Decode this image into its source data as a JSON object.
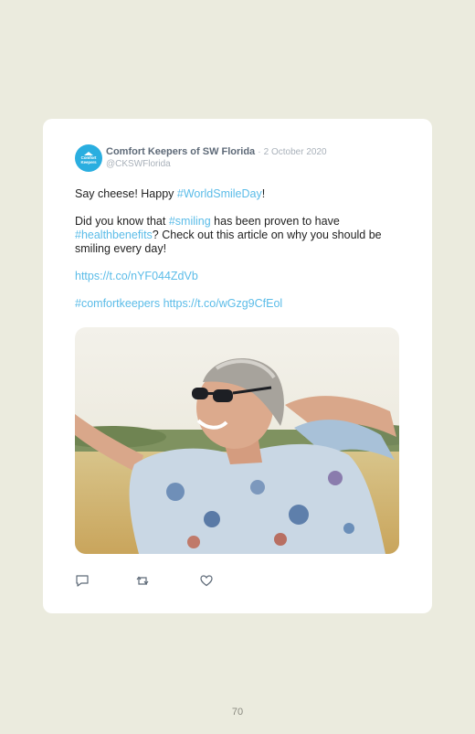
{
  "tweet": {
    "author_name": "Comfort Keepers of SW Florida",
    "separator": "·",
    "date": "2 October 2020",
    "handle": "@CKSWFlorida",
    "avatar_text_line1": "Comfort",
    "avatar_text_line2": "Keepers",
    "para1_text": "Say cheese! Happy ",
    "para1_tag": "#WorldSmileDay",
    "para1_end": "!",
    "para2_text1": "Did you know that ",
    "para2_tag1": "#smiling",
    "para2_text2": " has been proven to have ",
    "para2_tag2": "#healthbenefits",
    "para2_text3": "? Check out this article on why you should be smiling every day!",
    "link1": "https://t.co/nYF044ZdVb",
    "tag3": "#comfortkeepers",
    "link2": "https://t.co/wGzg9CfEol"
  },
  "actions": {
    "reply_icon": "reply-icon",
    "retweet_icon": "retweet-icon",
    "like_icon": "heart-icon"
  },
  "colors": {
    "background": "#ebebde",
    "link": "#5bbce8",
    "avatar": "#2aaee0"
  },
  "page": {
    "number": "70"
  }
}
